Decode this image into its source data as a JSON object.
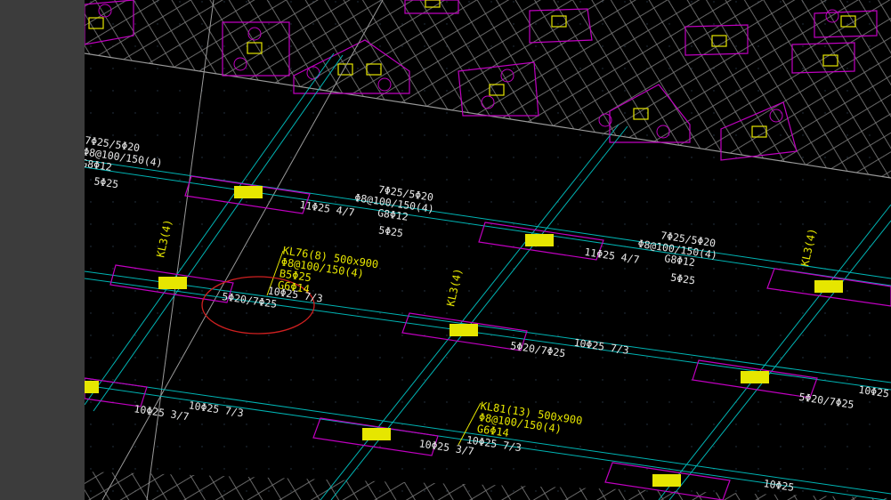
{
  "colors": {
    "panel": "#3c3c3c",
    "background": "#000000",
    "beam_outline": "#00b4b4",
    "column_outline": "#c000c0",
    "column_fill": "#e6e600",
    "annotation_yellow": "#e6e600",
    "annotation_white": "#e8e8e8",
    "hatch": "#8a8a8a",
    "selection_circle": "#d02020"
  },
  "annotations": {
    "top_left": {
      "l1": "7Φ25/5Φ20",
      "l2": "Φ8@100/150(4)",
      "l3": "G8Φ12",
      "l4": "5Φ25"
    },
    "top_mid": {
      "l1": "7Φ25/5Φ20",
      "l2": "Φ8@100/150(4)",
      "l3": "G8Φ12",
      "l4": "11Φ25 4/7",
      "l5": "5Φ25"
    },
    "right_mid": {
      "l1": "7Φ25/5Φ20",
      "l2": "Φ8@100/150(4)",
      "l3": "G8Φ12",
      "l4": "11Φ25 4/7",
      "l5": "5Φ25"
    },
    "kl76": {
      "title": "KL76(8) 500x900",
      "l2": "Φ8@100/150(4)",
      "l3": "B5Φ25",
      "l4": "G6Φ14",
      "l5": "10Φ25 7/3",
      "l6": "5Φ20/7Φ25"
    },
    "mid_row": {
      "a": "10Φ25 7/3",
      "b": "5Φ20/7Φ25"
    },
    "kl81": {
      "title": "KL81(13) 500x900",
      "l2": "Φ8@100/150(4)",
      "l3": "G6Φ14",
      "l4": "10Φ25 7/3",
      "l5": "10Φ25 3/7"
    },
    "bottom_left": {
      "a": "10Φ25 7/3",
      "b": "10Φ25 3/7"
    },
    "right_edge": {
      "a": "10Φ25",
      "b": "5Φ20/7Φ25",
      "c": "10Φ25"
    },
    "v_tags": {
      "a": "KL3(4)",
      "b": "KL3(4)",
      "c": "KL3(4)"
    }
  }
}
